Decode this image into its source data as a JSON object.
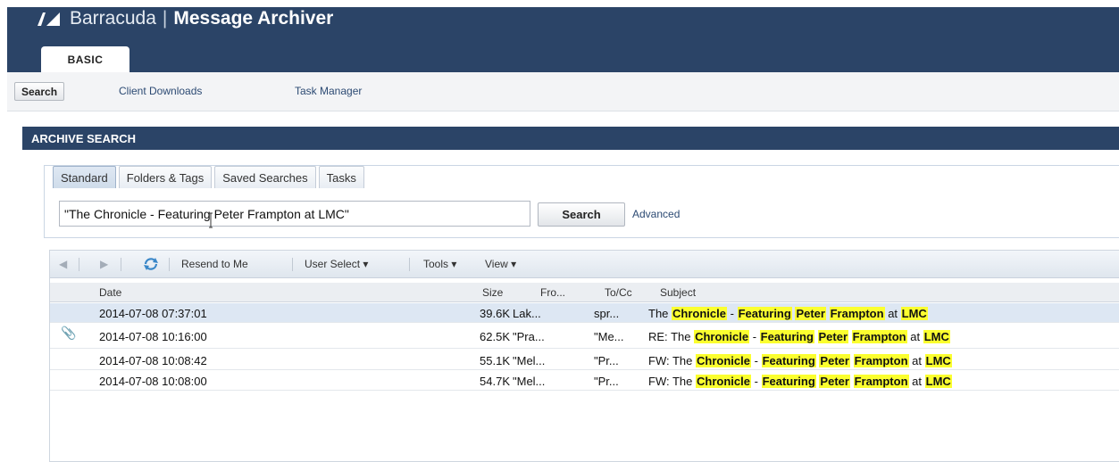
{
  "header": {
    "company": "Barracuda",
    "separator": "|",
    "product": "Message Archiver",
    "tab": "BASIC",
    "brand_color": "#2b4467"
  },
  "subnav": {
    "search_label": "Search",
    "client_downloads_label": "Client Downloads",
    "task_manager_label": "Task Manager"
  },
  "archive": {
    "title": "ARCHIVE SEARCH",
    "tabs": [
      {
        "label": "Standard",
        "active": true
      },
      {
        "label": "Folders & Tags",
        "active": false
      },
      {
        "label": "Saved Searches",
        "active": false
      },
      {
        "label": "Tasks",
        "active": false
      }
    ],
    "query_value": "\"The Chronicle - Featuring Peter Frampton at LMC\"",
    "search_button": "Search",
    "advanced_link": "Advanced"
  },
  "toolbar": {
    "prev_icon": "triangle-left-icon",
    "next_icon": "triangle-right-icon",
    "refresh_icon": "refresh-icon",
    "resend": "Resend to Me",
    "user_select": "User Select",
    "tools": "Tools",
    "view": "View"
  },
  "grid": {
    "columns": {
      "date": "Date",
      "size": "Size",
      "from": "Fro...",
      "tocc": "To/Cc",
      "subject": "Subject"
    },
    "highlight_color": "#fbff2f",
    "rows": [
      {
        "date": "2014-07-08 07:37:01",
        "size": "39.6K",
        "from": "Lak...",
        "to": "spr...",
        "prefix": "",
        "selected": true,
        "attachment": false
      },
      {
        "date": "2014-07-08 10:16:00",
        "size": "62.5K",
        "from": "\"Pra...",
        "to": "\"Me...",
        "prefix": "RE: ",
        "selected": false,
        "attachment": true
      },
      {
        "date": "2014-07-08 10:08:42",
        "size": "55.1K",
        "from": "\"Mel...",
        "to": "\"Pr...",
        "prefix": "FW: ",
        "selected": false,
        "attachment": false
      },
      {
        "date": "2014-07-08 10:08:00",
        "size": "54.7K",
        "from": "\"Mel...",
        "to": "\"Pr...",
        "prefix": "FW: ",
        "selected": false,
        "attachment": false
      }
    ],
    "subject_parts": {
      "the": "The",
      "chronicle": "Chronicle",
      "dash": "-",
      "featuring": "Featuring",
      "peter": "Peter",
      "frampton": "Frampton",
      "at": "at",
      "lmc": "LMC"
    }
  }
}
